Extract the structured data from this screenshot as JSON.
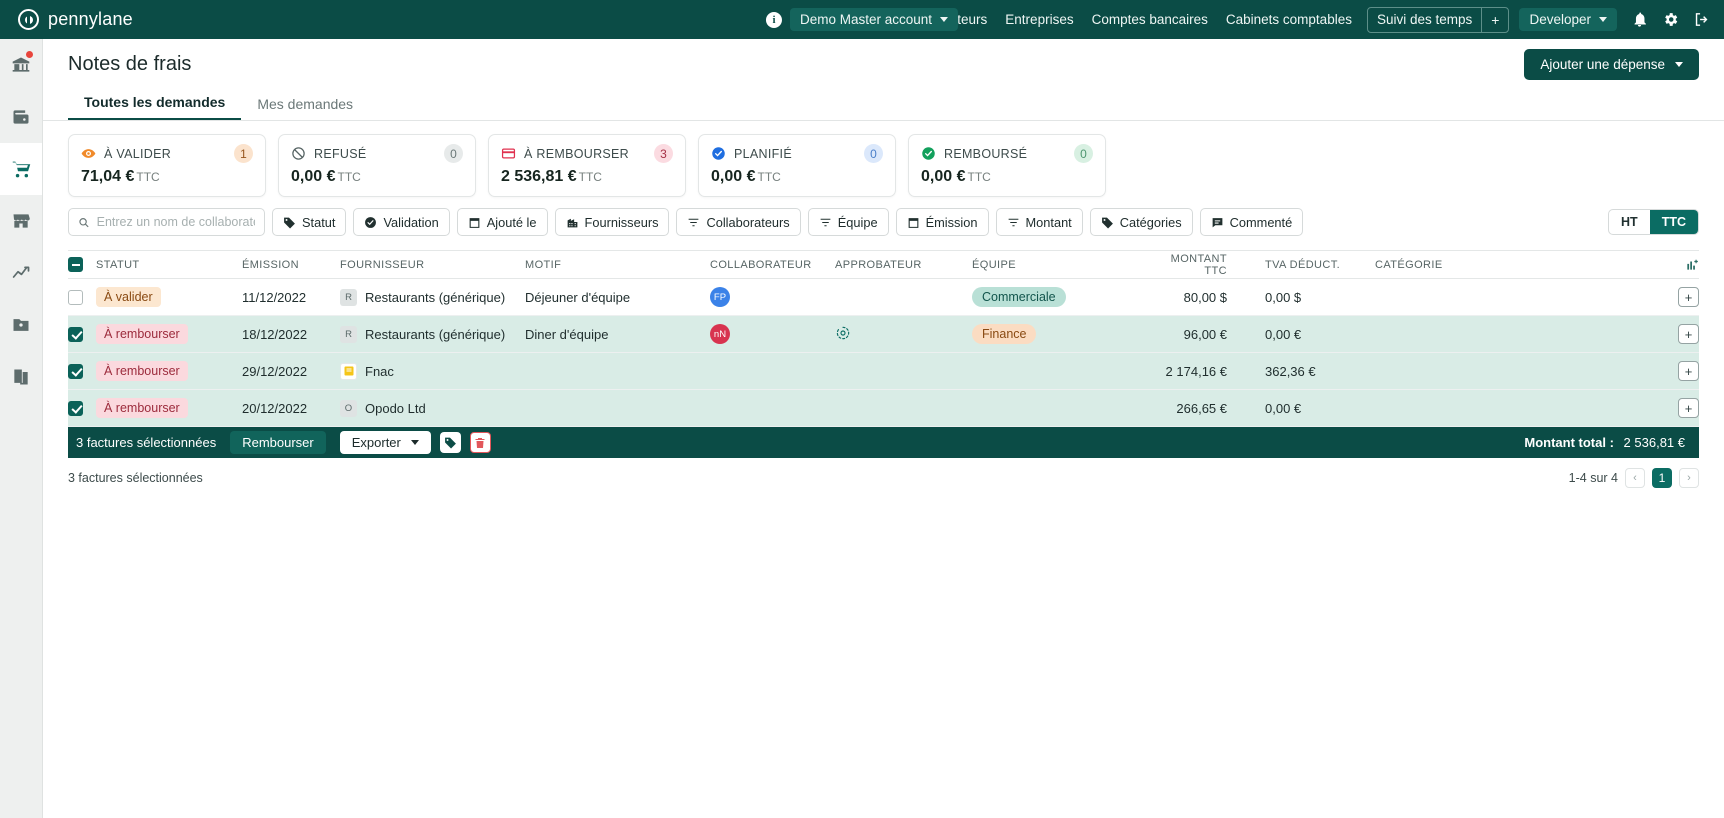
{
  "topbar": {
    "brand": "pennylane",
    "account": "Demo Master account",
    "nav": [
      {
        "label": "Utilisateurs"
      },
      {
        "label": "Entreprises"
      },
      {
        "label": "Comptes bancaires"
      },
      {
        "label": "Cabinets comptables"
      }
    ],
    "suivi_label": "Suivi des temps",
    "suivi_plus": "+",
    "developer": "Developer",
    "icons": [
      "bell-icon",
      "gear-icon",
      "logout-icon"
    ]
  },
  "sidebar": {
    "items": [
      {
        "name": "bank-icon",
        "badge": true
      },
      {
        "name": "wallet-icon",
        "badge": false
      },
      {
        "name": "cart-icon",
        "badge": false,
        "active": true
      },
      {
        "name": "store-icon",
        "badge": false
      },
      {
        "name": "analytics-icon",
        "badge": false
      },
      {
        "name": "contacts-icon",
        "badge": false
      },
      {
        "name": "books-icon",
        "badge": false
      }
    ]
  },
  "page": {
    "title": "Notes de frais",
    "add_button": "Ajouter une dépense"
  },
  "tabs": [
    {
      "label": "Toutes les demandes",
      "active": true
    },
    {
      "label": "Mes demandes",
      "active": false
    }
  ],
  "stats": [
    {
      "label": "À VALIDER",
      "count": "1",
      "amount": "71,04 €",
      "unit": "TTC",
      "icon": "eye-icon",
      "icon_color": "#f08a2a",
      "count_bg": "#fbe3cd",
      "count_color": "#96551c"
    },
    {
      "label": "REFUSÉ",
      "count": "0",
      "amount": "0,00 €",
      "unit": "TTC",
      "icon": "ban-icon",
      "icon_color": "#566464",
      "count_bg": "#e7eaea",
      "count_color": "#6b7878"
    },
    {
      "label": "À REMBOURSER",
      "count": "3",
      "amount": "2 536,81 €",
      "unit": "TTC",
      "icon": "card-icon",
      "icon_color": "#e0314f",
      "count_bg": "#fbdbe1",
      "count_color": "#a63146"
    },
    {
      "label": "PLANIFIÉ",
      "count": "0",
      "amount": "0,00 €",
      "unit": "TTC",
      "icon": "check-circle-icon",
      "icon_color": "#1f6ee0",
      "count_bg": "#dbe8fb",
      "count_color": "#4a7fc9"
    },
    {
      "label": "REMBOURSÉ",
      "count": "0",
      "amount": "0,00 €",
      "unit": "TTC",
      "icon": "check-circle-icon",
      "icon_color": "#12a05c",
      "count_bg": "#d8f0e2",
      "count_color": "#4e9670"
    }
  ],
  "search": {
    "placeholder": "Entrez un nom de collaborateur"
  },
  "filters": [
    {
      "label": "Statut",
      "icon": "tag-icon"
    },
    {
      "label": "Validation",
      "icon": "check-shield-icon"
    },
    {
      "label": "Ajouté le",
      "icon": "calendar-icon"
    },
    {
      "label": "Fournisseurs",
      "icon": "building-icon"
    },
    {
      "label": "Collaborateurs",
      "icon": "filter-icon"
    },
    {
      "label": "Équipe",
      "icon": "filter-icon"
    },
    {
      "label": "Émission",
      "icon": "calendar-icon"
    },
    {
      "label": "Montant",
      "icon": "filter-icon"
    },
    {
      "label": "Catégories",
      "icon": "tag-icon"
    },
    {
      "label": "Commenté",
      "icon": "comment-icon"
    }
  ],
  "tax_toggle": {
    "options": [
      "HT",
      "TTC"
    ],
    "selected": "TTC"
  },
  "table": {
    "columns": [
      "STATUT",
      "ÉMISSION",
      "FOURNISSEUR",
      "MOTIF",
      "COLLABORATEUR",
      "APPROBATEUR",
      "ÉQUIPE",
      "MONTANT TTC",
      "TVA DÉDUCT.",
      "CATÉGORIE"
    ],
    "settings_icon": "column-settings-icon",
    "rows": [
      {
        "selected": false,
        "statut": "À valider",
        "statut_style": "pill-valider",
        "emission": "11/12/2022",
        "supplier_initial": "R",
        "supplier": "Restaurants (générique)",
        "motif": "Déjeuner d'équipe",
        "collaborateur": "FP",
        "collab_color": "#3b82e8",
        "approbateur": "",
        "equipe": "Commerciale",
        "equipe_style": "pill-teal",
        "montant": "80,00 $",
        "tva": "0,00 $",
        "categorie": "",
        "add_button": "+"
      },
      {
        "selected": true,
        "statut": "À rembourser",
        "statut_style": "pill-rembourser",
        "emission": "18/12/2022",
        "supplier_initial": "R",
        "supplier": "Restaurants (générique)",
        "motif": "Diner d'équipe",
        "collaborateur": "nN",
        "collab_color": "#d8334f",
        "approbateur": "pending-approval-icon",
        "equipe": "Finance",
        "equipe_style": "pill-orange",
        "montant": "96,00 €",
        "tva": "0,00 €",
        "categorie": "",
        "add_button": "+"
      },
      {
        "selected": true,
        "statut": "À rembourser",
        "statut_style": "pill-rembourser",
        "emission": "29/12/2022",
        "supplier_initial": "F",
        "supplier": "Fnac",
        "motif": "",
        "collaborateur": "",
        "collab_color": "",
        "approbateur": "",
        "equipe": "",
        "equipe_style": "",
        "montant": "2 174,16 €",
        "tva": "362,36 €",
        "categorie": "",
        "add_button": "+"
      },
      {
        "selected": true,
        "statut": "À rembourser",
        "statut_style": "pill-rembourser",
        "emission": "20/12/2022",
        "supplier_initial": "O",
        "supplier": "Opodo Ltd",
        "motif": "",
        "collaborateur": "",
        "collab_color": "",
        "approbateur": "",
        "equipe": "",
        "equipe_style": "",
        "montant": "266,65 €",
        "tva": "0,00 €",
        "categorie": "",
        "add_button": "+"
      }
    ]
  },
  "actionbar": {
    "selection_text": "3 factures sélectionnées",
    "rembourser": "Rembourser",
    "exporter": "Exporter",
    "tag_icon": "tag-icon",
    "delete_icon": "trash-icon",
    "total_label": "Montant total :",
    "total_value": "2 536,81 €"
  },
  "footer": {
    "selection_text": "3 factures sélectionnées",
    "range": "1-4 sur 4",
    "prev": "‹",
    "page": "1",
    "next": "›"
  }
}
